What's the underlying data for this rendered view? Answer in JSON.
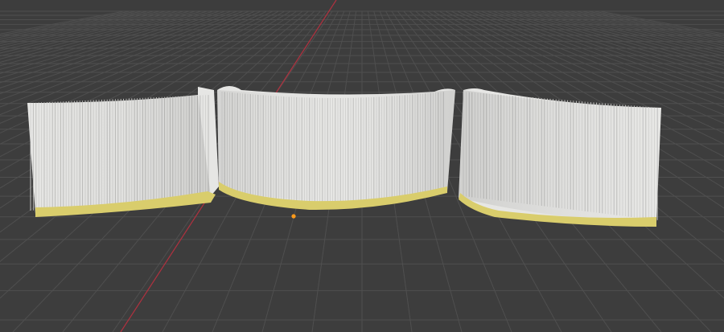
{
  "viewport": {
    "background_color": "#3d3d3d",
    "grid_color": "#4f4f4f",
    "x_axis_color": "#b0313f",
    "origin_marker_color": "#ff9a1a"
  },
  "scene": {
    "objects": [
      {
        "name": "curtain-panel-left",
        "fabric_color": "#e6e6e4",
        "hem_color": "#d9cd6c"
      },
      {
        "name": "curtain-panel-center",
        "fabric_color": "#e6e6e4",
        "hem_color": "#d9cd6c"
      },
      {
        "name": "curtain-panel-right",
        "fabric_color": "#e6e6e4",
        "hem_color": "#d9cd6c"
      }
    ]
  }
}
